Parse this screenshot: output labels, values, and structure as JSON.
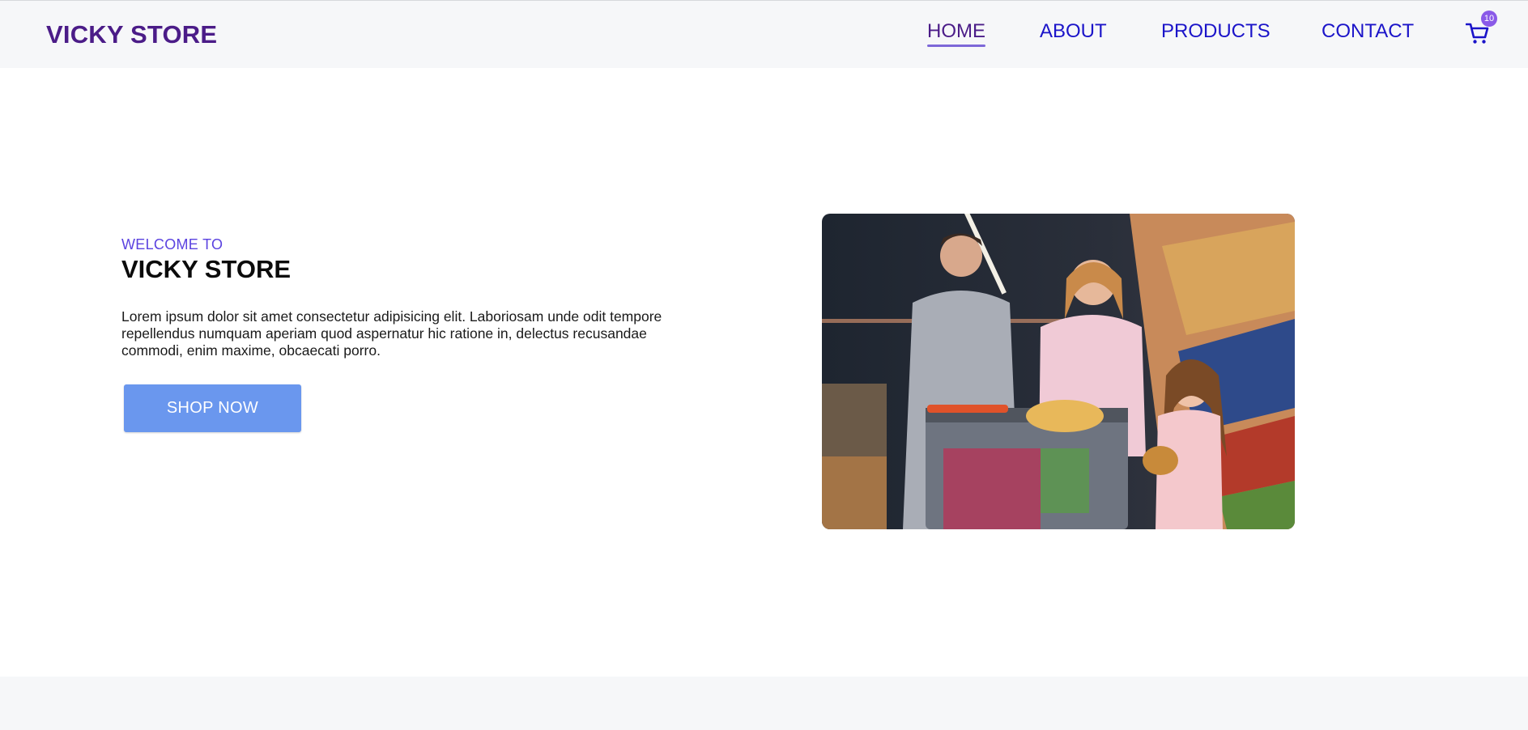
{
  "header": {
    "brand": "VICKY STORE",
    "nav": [
      {
        "label": "HOME",
        "active": true
      },
      {
        "label": "ABOUT",
        "active": false
      },
      {
        "label": "PRODUCTS",
        "active": false
      },
      {
        "label": "CONTACT",
        "active": false
      }
    ],
    "cart": {
      "icon": "cart-icon",
      "count": "10"
    }
  },
  "hero": {
    "welcome": "WELCOME TO",
    "title": "VICKY STORE",
    "description": "Lorem ipsum dolor sit amet consectetur adipisicing elit. Laboriosam unde odit tempore repellendus numquam aperiam quod aspernatur hic ratione in, delectus recusandae commodi, enim maxime, obcaecati porro.",
    "button": "SHOP NOW"
  },
  "colors": {
    "brand": "#4b1c88",
    "nav_link": "#1b14c9",
    "accent": "#5b43e0",
    "button": "#6a97ee",
    "badge": "#8a5ae8",
    "band": "#f6f7f9"
  }
}
